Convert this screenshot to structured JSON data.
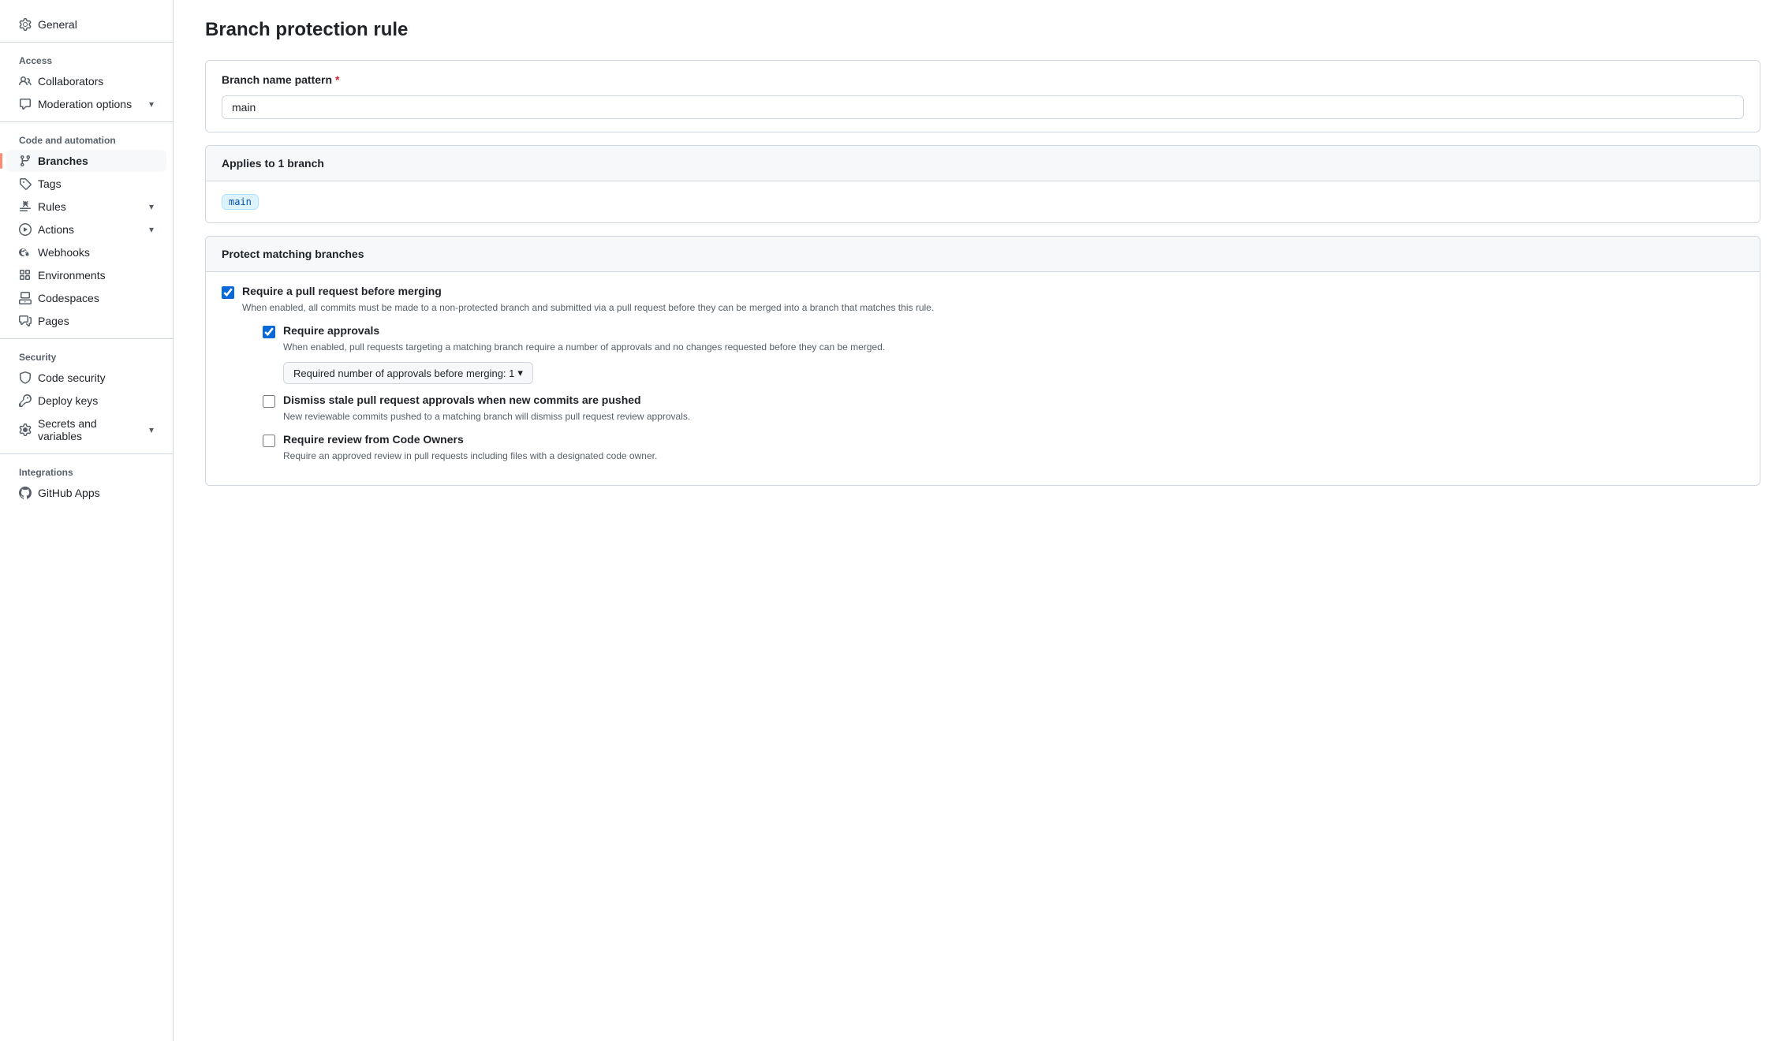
{
  "page": {
    "title": "Branch protection rule"
  },
  "sidebar": {
    "top_items": [
      {
        "id": "general",
        "label": "General",
        "icon": "gear"
      }
    ],
    "sections": [
      {
        "label": "Access",
        "items": [
          {
            "id": "collaborators",
            "label": "Collaborators",
            "icon": "person"
          },
          {
            "id": "moderation-options",
            "label": "Moderation options",
            "icon": "comment",
            "hasChevron": true
          }
        ]
      },
      {
        "label": "Code and automation",
        "items": [
          {
            "id": "branches",
            "label": "Branches",
            "icon": "git-branch",
            "active": true
          },
          {
            "id": "tags",
            "label": "Tags",
            "icon": "tag"
          },
          {
            "id": "rules",
            "label": "Rules",
            "icon": "rules",
            "hasChevron": true
          },
          {
            "id": "actions",
            "label": "Actions",
            "icon": "play",
            "hasChevron": true
          },
          {
            "id": "webhooks",
            "label": "Webhooks",
            "icon": "webhook"
          },
          {
            "id": "environments",
            "label": "Environments",
            "icon": "grid"
          },
          {
            "id": "codespaces",
            "label": "Codespaces",
            "icon": "codespaces"
          },
          {
            "id": "pages",
            "label": "Pages",
            "icon": "pages"
          }
        ]
      },
      {
        "label": "Security",
        "items": [
          {
            "id": "code-security",
            "label": "Code security",
            "icon": "shield"
          },
          {
            "id": "deploy-keys",
            "label": "Deploy keys",
            "icon": "key"
          },
          {
            "id": "secrets-variables",
            "label": "Secrets and variables",
            "icon": "secret",
            "hasChevron": true
          }
        ]
      },
      {
        "label": "Integrations",
        "items": [
          {
            "id": "github-apps",
            "label": "GitHub Apps",
            "icon": "github"
          }
        ]
      }
    ]
  },
  "main": {
    "branch_name_pattern": {
      "label": "Branch name pattern",
      "required": true,
      "value": "main"
    },
    "applies_to": {
      "label": "Applies to 1 branch",
      "branch_tag": "main"
    },
    "protect_section": {
      "label": "Protect matching branches",
      "items": [
        {
          "id": "require-pr",
          "label": "Require a pull request before merging",
          "checked": true,
          "description": "When enabled, all commits must be made to a non-protected branch and submitted via a pull request before they can be merged into a branch that matches this rule.",
          "nested": [
            {
              "id": "require-approvals",
              "label": "Require approvals",
              "checked": true,
              "description": "When enabled, pull requests targeting a matching branch require a number of approvals and no changes requested before they can be merged.",
              "has_dropdown": true,
              "dropdown_label": "Required number of approvals before merging: 1"
            },
            {
              "id": "dismiss-stale",
              "label": "Dismiss stale pull request approvals when new commits are pushed",
              "checked": false,
              "description": "New reviewable commits pushed to a matching branch will dismiss pull request review approvals."
            },
            {
              "id": "require-code-owners",
              "label": "Require review from Code Owners",
              "checked": false,
              "description": "Require an approved review in pull requests including files with a designated code owner."
            }
          ]
        }
      ]
    }
  }
}
